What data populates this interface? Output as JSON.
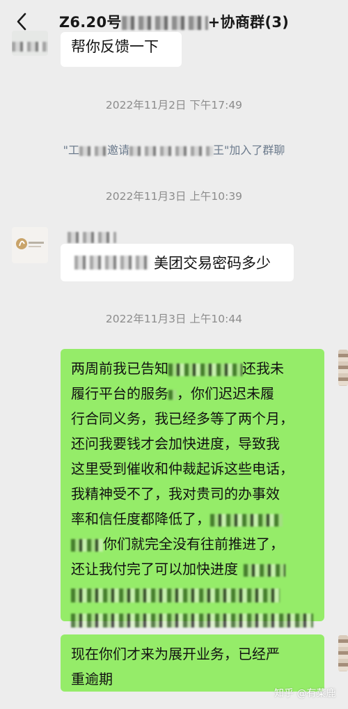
{
  "header": {
    "title_prefix": "Z6.20号",
    "title_suffix": "+协商群(3)"
  },
  "messages": {
    "top_partial": "帮你反馈一下",
    "ts1": "2022年11月2日 下午17:49",
    "system_prefix": "\"工",
    "system_mid": "邀请",
    "system_end": "王\"加入了群聊",
    "ts2": "2022年11月3日 上午10:39",
    "question": "美团交易密码多少",
    "ts3": "2022年11月3日 上午10:44",
    "long_lines": [
      "两周前我已告知",
      "还我未",
      "履行平台的服务",
      "，你们迟迟未履",
      "行合同义务，我已经多等了两个月，",
      "还问我要钱才会加快进度，导致我",
      "这里受到催收和仲裁起诉这些电话，",
      "我精神受不了，我对贵司的办事效",
      "率和信任度都降低了，",
      "你们就完全没有往前推进了，",
      "还让我付完了可以加快进度"
    ],
    "last_lines": [
      "现在你们才来为展开业务，已经严",
      "重逾期"
    ]
  },
  "watermark": "知乎 @有菜鹿",
  "colors": {
    "background": "#ededed",
    "self_bubble": "#95ec69",
    "other_bubble": "#ffffff",
    "timestamp": "#8c8c8c"
  },
  "icons": {
    "back": "chevron-left-icon"
  }
}
